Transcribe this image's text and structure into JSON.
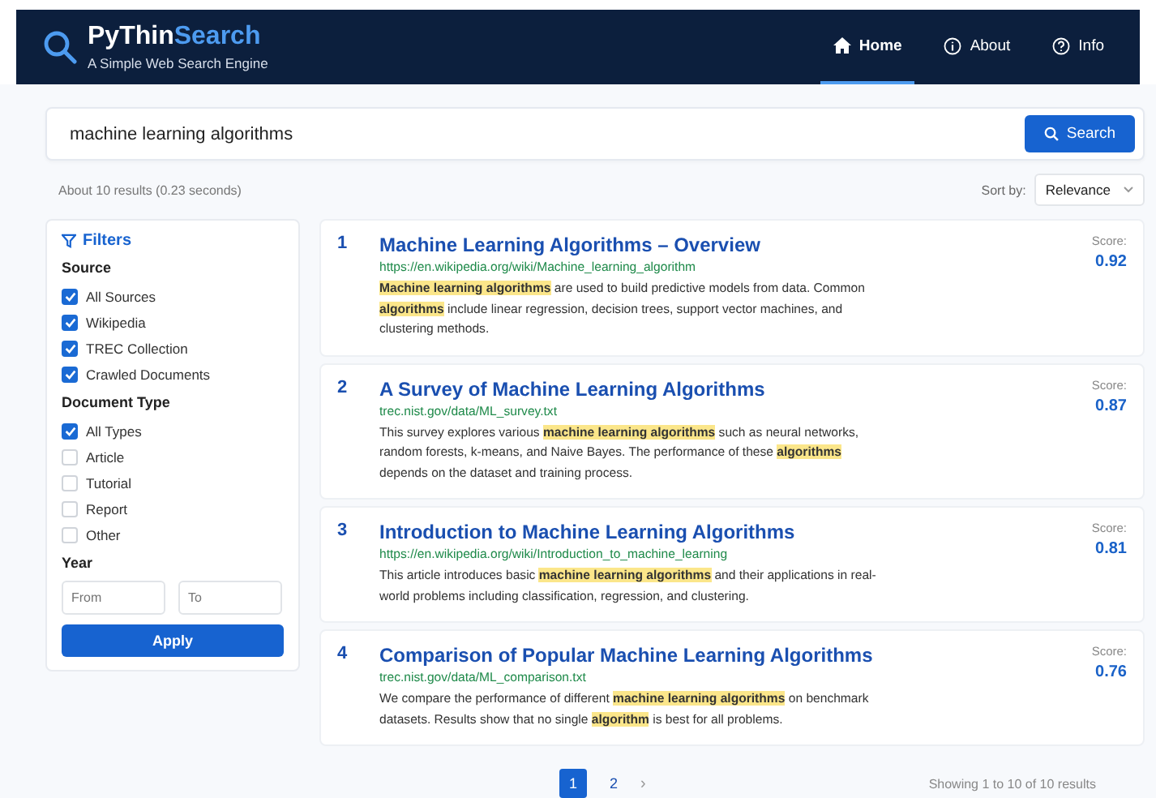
{
  "header": {
    "brand_main": "PyThin",
    "brand_accent": "Search",
    "tagline": "A Simple Web Search Engine",
    "nav": [
      {
        "label": "Home",
        "kind": "home",
        "selected": true
      },
      {
        "label": "About",
        "kind": "info",
        "selected": false
      },
      {
        "label": "Info",
        "kind": "help",
        "selected": false
      }
    ]
  },
  "search": {
    "value": "machine learning algorithms",
    "button": "Search"
  },
  "result_stats": "About 10 results (0.23 seconds)",
  "sort": {
    "label": "Sort by:",
    "value": "Relevance"
  },
  "filters": {
    "title": "Filters",
    "groups": [
      {
        "title": "Source",
        "options": [
          {
            "label": "All Sources",
            "checked": true
          },
          {
            "label": "Wikipedia",
            "checked": true
          },
          {
            "label": "TREC Collection",
            "checked": true
          },
          {
            "label": "Crawled Documents",
            "checked": true
          }
        ]
      },
      {
        "title": "Document Type",
        "options": [
          {
            "label": "All Types",
            "checked": true
          },
          {
            "label": "Article",
            "checked": false
          },
          {
            "label": "Tutorial",
            "checked": false
          },
          {
            "label": "Report",
            "checked": false
          },
          {
            "label": "Other",
            "checked": false
          }
        ]
      }
    ],
    "year": {
      "title": "Year",
      "from_placeholder": "From",
      "to_placeholder": "To"
    },
    "apply": "Apply"
  },
  "results": [
    {
      "rank": "1",
      "title": "Machine Learning Algorithms – Overview",
      "url": "https://en.wikipedia.org/wiki/Machine_learning_algorithm",
      "snippet": "**Machine learning algorithms** are used to build predictive models from data. Common **algorithms** include linear regression, decision trees, support vector machines, and clustering methods.",
      "score_label": "Score:",
      "score": "0.92"
    },
    {
      "rank": "2",
      "title": "A Survey of Machine Learning Algorithms",
      "url": "trec.nist.gov/data/ML_survey.txt",
      "snippet": "This survey explores various **machine learning algorithms** such as neural networks, random forests, k-means, and Naive Bayes. The performance of these **algorithms** depends on the dataset and training process.",
      "score_label": "Score:",
      "score": "0.87"
    },
    {
      "rank": "3",
      "title": "Introduction to Machine Learning Algorithms",
      "url": "https://en.wikipedia.org/wiki/Introduction_to_machine_learning",
      "snippet": "This article introduces basic **machine learning algorithms** and their applications in real-world problems including classification, regression, and clustering.",
      "score_label": "Score:",
      "score": "0.81"
    },
    {
      "rank": "4",
      "title": "Comparison of Popular Machine Learning Algorithms",
      "url": "trec.nist.gov/data/ML_comparison.txt",
      "snippet": "We compare the performance of different **machine learning algorithms** on benchmark datasets. Results show that no single **algorithm** is best for all problems.",
      "score_label": "Score:",
      "score": "0.76"
    }
  ],
  "pagination": {
    "pages": [
      {
        "label": "1",
        "selected": true
      },
      {
        "label": "2",
        "selected": false
      }
    ],
    "next": "›",
    "summary": "Showing 1 to 10 of 10 results"
  }
}
